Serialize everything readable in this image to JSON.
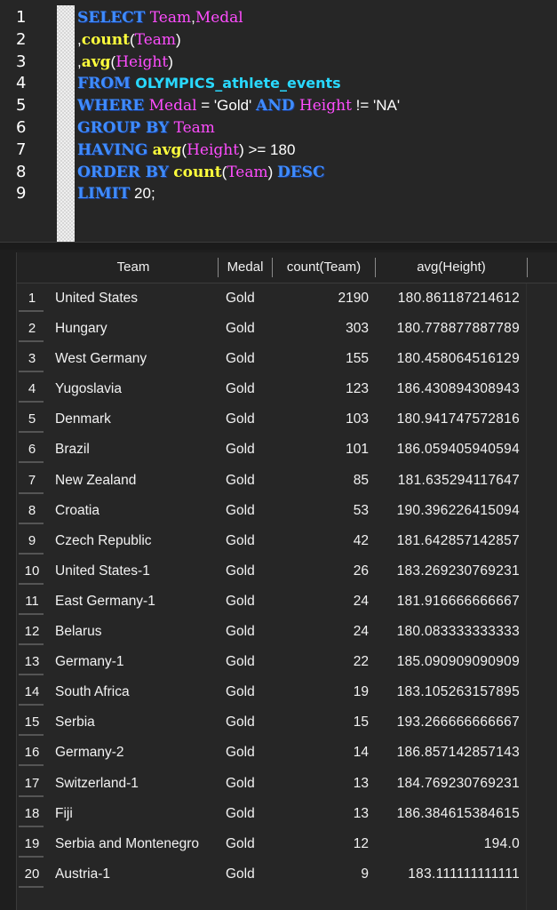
{
  "editor": {
    "line_numbers": [
      "1",
      "2",
      "3",
      "4",
      "5",
      "6",
      "7",
      "8",
      "9"
    ],
    "lines": [
      [
        {
          "t": "SELECT",
          "c": "kw"
        },
        {
          "t": " ",
          "c": ""
        },
        {
          "t": "Team",
          "c": "id"
        },
        {
          "t": ",",
          "c": "str"
        },
        {
          "t": "Medal",
          "c": "id"
        }
      ],
      [
        {
          "t": ",",
          "c": "str"
        },
        {
          "t": "count",
          "c": "fn"
        },
        {
          "t": "(",
          "c": "str"
        },
        {
          "t": "Team",
          "c": "id"
        },
        {
          "t": ")",
          "c": "str"
        }
      ],
      [
        {
          "t": ",",
          "c": "str"
        },
        {
          "t": "avg",
          "c": "fn"
        },
        {
          "t": "(",
          "c": "str"
        },
        {
          "t": "Height",
          "c": "id"
        },
        {
          "t": ")",
          "c": "str"
        }
      ],
      [
        {
          "t": "FROM",
          "c": "kw"
        },
        {
          "t": " ",
          "c": ""
        },
        {
          "t": "OLYMPICS_athlete_events",
          "c": "tbl"
        }
      ],
      [
        {
          "t": "WHERE",
          "c": "kw"
        },
        {
          "t": " ",
          "c": ""
        },
        {
          "t": "Medal",
          "c": "id"
        },
        {
          "t": " = 'Gold' ",
          "c": "str"
        },
        {
          "t": "AND",
          "c": "kw"
        },
        {
          "t": " ",
          "c": ""
        },
        {
          "t": "Height",
          "c": "id"
        },
        {
          "t": " != 'NA'",
          "c": "str"
        }
      ],
      [
        {
          "t": "GROUP BY",
          "c": "kw"
        },
        {
          "t": " ",
          "c": ""
        },
        {
          "t": "Team",
          "c": "id"
        }
      ],
      [
        {
          "t": "HAVING",
          "c": "kw"
        },
        {
          "t": " ",
          "c": ""
        },
        {
          "t": "avg",
          "c": "fn"
        },
        {
          "t": "(",
          "c": "str"
        },
        {
          "t": "Height",
          "c": "id"
        },
        {
          "t": ") >= 180",
          "c": "str"
        }
      ],
      [
        {
          "t": "ORDER BY",
          "c": "kw"
        },
        {
          "t": " ",
          "c": ""
        },
        {
          "t": "count",
          "c": "fn"
        },
        {
          "t": "(",
          "c": "str"
        },
        {
          "t": "Team",
          "c": "id"
        },
        {
          "t": ") ",
          "c": "str"
        },
        {
          "t": "DESC",
          "c": "kw"
        }
      ],
      [
        {
          "t": "LIMIT",
          "c": "kw"
        },
        {
          "t": " 20;",
          "c": "str"
        }
      ]
    ]
  },
  "results": {
    "columns": [
      "Team",
      "Medal",
      "count(Team)",
      "avg(Height)"
    ],
    "rows": [
      [
        "1",
        "United States",
        "Gold",
        "2190",
        "180.861187214612"
      ],
      [
        "2",
        "Hungary",
        "Gold",
        "303",
        "180.778877887789"
      ],
      [
        "3",
        "West Germany",
        "Gold",
        "155",
        "180.458064516129"
      ],
      [
        "4",
        "Yugoslavia",
        "Gold",
        "123",
        "186.430894308943"
      ],
      [
        "5",
        "Denmark",
        "Gold",
        "103",
        "180.941747572816"
      ],
      [
        "6",
        "Brazil",
        "Gold",
        "101",
        "186.059405940594"
      ],
      [
        "7",
        "New Zealand",
        "Gold",
        "85",
        "181.635294117647"
      ],
      [
        "8",
        "Croatia",
        "Gold",
        "53",
        "190.396226415094"
      ],
      [
        "9",
        "Czech Republic",
        "Gold",
        "42",
        "181.642857142857"
      ],
      [
        "10",
        "United States-1",
        "Gold",
        "26",
        "183.269230769231"
      ],
      [
        "11",
        "East Germany-1",
        "Gold",
        "24",
        "181.916666666667"
      ],
      [
        "12",
        "Belarus",
        "Gold",
        "24",
        "180.083333333333"
      ],
      [
        "13",
        "Germany-1",
        "Gold",
        "22",
        "185.090909090909"
      ],
      [
        "14",
        "South Africa",
        "Gold",
        "19",
        "183.105263157895"
      ],
      [
        "15",
        "Serbia",
        "Gold",
        "15",
        "193.266666666667"
      ],
      [
        "16",
        "Germany-2",
        "Gold",
        "14",
        "186.857142857143"
      ],
      [
        "17",
        "Switzerland-1",
        "Gold",
        "13",
        "184.769230769231"
      ],
      [
        "18",
        "Fiji",
        "Gold",
        "13",
        "186.384615384615"
      ],
      [
        "19",
        "Serbia and Montenegro",
        "Gold",
        "12",
        "194.0"
      ],
      [
        "20",
        "Austria-1",
        "Gold",
        "9",
        "183.111111111111"
      ]
    ]
  }
}
